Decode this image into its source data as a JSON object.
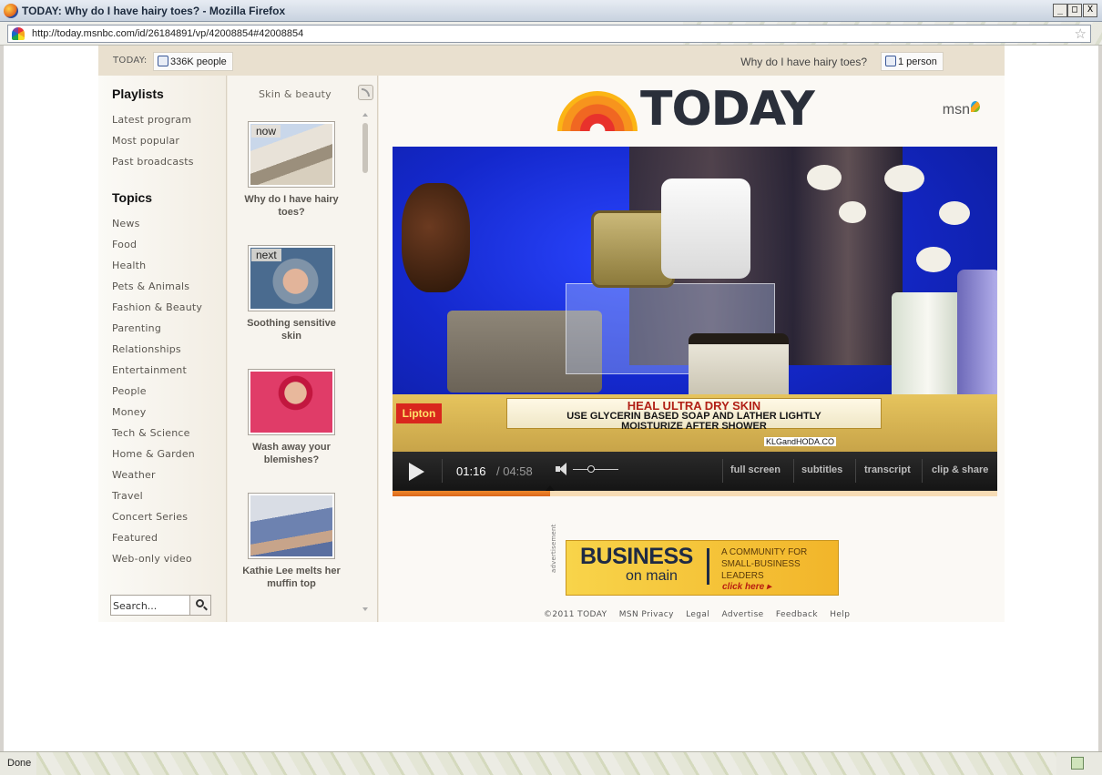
{
  "window": {
    "title": "TODAY: Why do I have hairy toes? - Mozilla Firefox",
    "url": "http://today.msnbc.com/id/26184891/vp/42008854#42008854",
    "buttons": [
      "_",
      "□",
      "X"
    ]
  },
  "topbar": {
    "brand_label": "TODAY:",
    "brand_likes": "336K people",
    "video_title": "Why do I have hairy toes?",
    "video_likes": "1 person"
  },
  "sidebar": {
    "playlists_heading": "Playlists",
    "playlists": [
      "Latest program",
      "Most popular",
      "Past broadcasts"
    ],
    "topics_heading": "Topics",
    "topics": [
      "News",
      "Food",
      "Health",
      "Pets & Animals",
      "Fashion & Beauty",
      "Parenting",
      "Relationships",
      "Entertainment",
      "People",
      "Money",
      "Tech & Science",
      "Home & Garden",
      "Weather",
      "Travel",
      "Concert Series",
      "Featured",
      "Web-only video"
    ],
    "search_value": "Search..."
  },
  "playlist": {
    "heading": "Skin & beauty",
    "items": [
      {
        "tag": "now",
        "caption": "Why do I have hairy toes?"
      },
      {
        "tag": "next",
        "caption": "Soothing sensitive skin"
      },
      {
        "tag": "",
        "caption": "Wash away your blemishes?"
      },
      {
        "tag": "",
        "caption": "Kathie Lee melts her muffin top"
      }
    ]
  },
  "logo": {
    "wordmark": "TODAY",
    "partner": "msn"
  },
  "video": {
    "sponsor": "Lipton",
    "headline": "HEAL ULTRA DRY SKIN",
    "line2": "USE GLYCERIN BASED SOAP AND LATHER LIGHTLY",
    "line3": "MOISTURIZE AFTER SHOWER",
    "handle": "KLGandHODA.CO",
    "current_time": "01:16",
    "total_time": "/ 04:58",
    "progress": 0.26,
    "volume": 0.4,
    "controls": [
      "full screen",
      "subtitles",
      "transcript",
      "clip & share"
    ]
  },
  "ad": {
    "label": "advertisement",
    "brand_line1": "BUSINESS",
    "brand_line2": "on main",
    "tagline": "A COMMUNITY FOR SMALL-BUSINESS LEADERS",
    "cta": "click here ▸"
  },
  "footer": [
    "©2011 TODAY",
    "MSN Privacy",
    "Legal",
    "Advertise",
    "Feedback",
    "Help"
  ],
  "status": {
    "text": "Done"
  },
  "colors": {
    "accent_orange": "#f08a2a",
    "page_beige": "#efe9de",
    "text_gray": "#5a5650"
  }
}
